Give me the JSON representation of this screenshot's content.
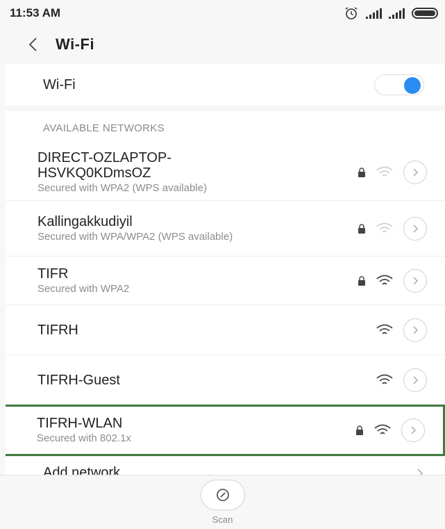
{
  "status_bar": {
    "time": "11:53 AM",
    "icons": [
      "alarm-icon",
      "signal-icon",
      "signal-icon",
      "battery-icon"
    ]
  },
  "header": {
    "back_icon": "chevron-left-icon",
    "title": "Wi-Fi"
  },
  "wifi_toggle": {
    "label": "Wi-Fi",
    "enabled": true,
    "accent_color": "#2a8cf0"
  },
  "networks": {
    "section_title": "AVAILABLE NETWORKS",
    "items": [
      {
        "name": "DIRECT-OZLAPTOP-HSVKQ0KDmsOZ",
        "subtitle": "Secured with WPA2 (WPS available)",
        "secured": true,
        "signal": "weak"
      },
      {
        "name": "Kallingakkudiyil",
        "subtitle": "Secured with WPA/WPA2 (WPS available)",
        "secured": true,
        "signal": "weak"
      },
      {
        "name": "TIFR",
        "subtitle": "Secured with WPA2",
        "secured": true,
        "signal": "strong"
      },
      {
        "name": "TIFRH",
        "subtitle": "",
        "secured": false,
        "signal": "strong"
      },
      {
        "name": "TIFRH-Guest",
        "subtitle": "",
        "secured": false,
        "signal": "strong"
      },
      {
        "name": "TIFRH-WLAN",
        "subtitle": "Secured with 802.1x",
        "secured": true,
        "signal": "strong",
        "highlighted": true
      }
    ],
    "add_network_label": "Add network",
    "highlight_color": "#3f7a3f"
  },
  "scan": {
    "label": "Scan",
    "icon": "scan-gauge-icon"
  }
}
